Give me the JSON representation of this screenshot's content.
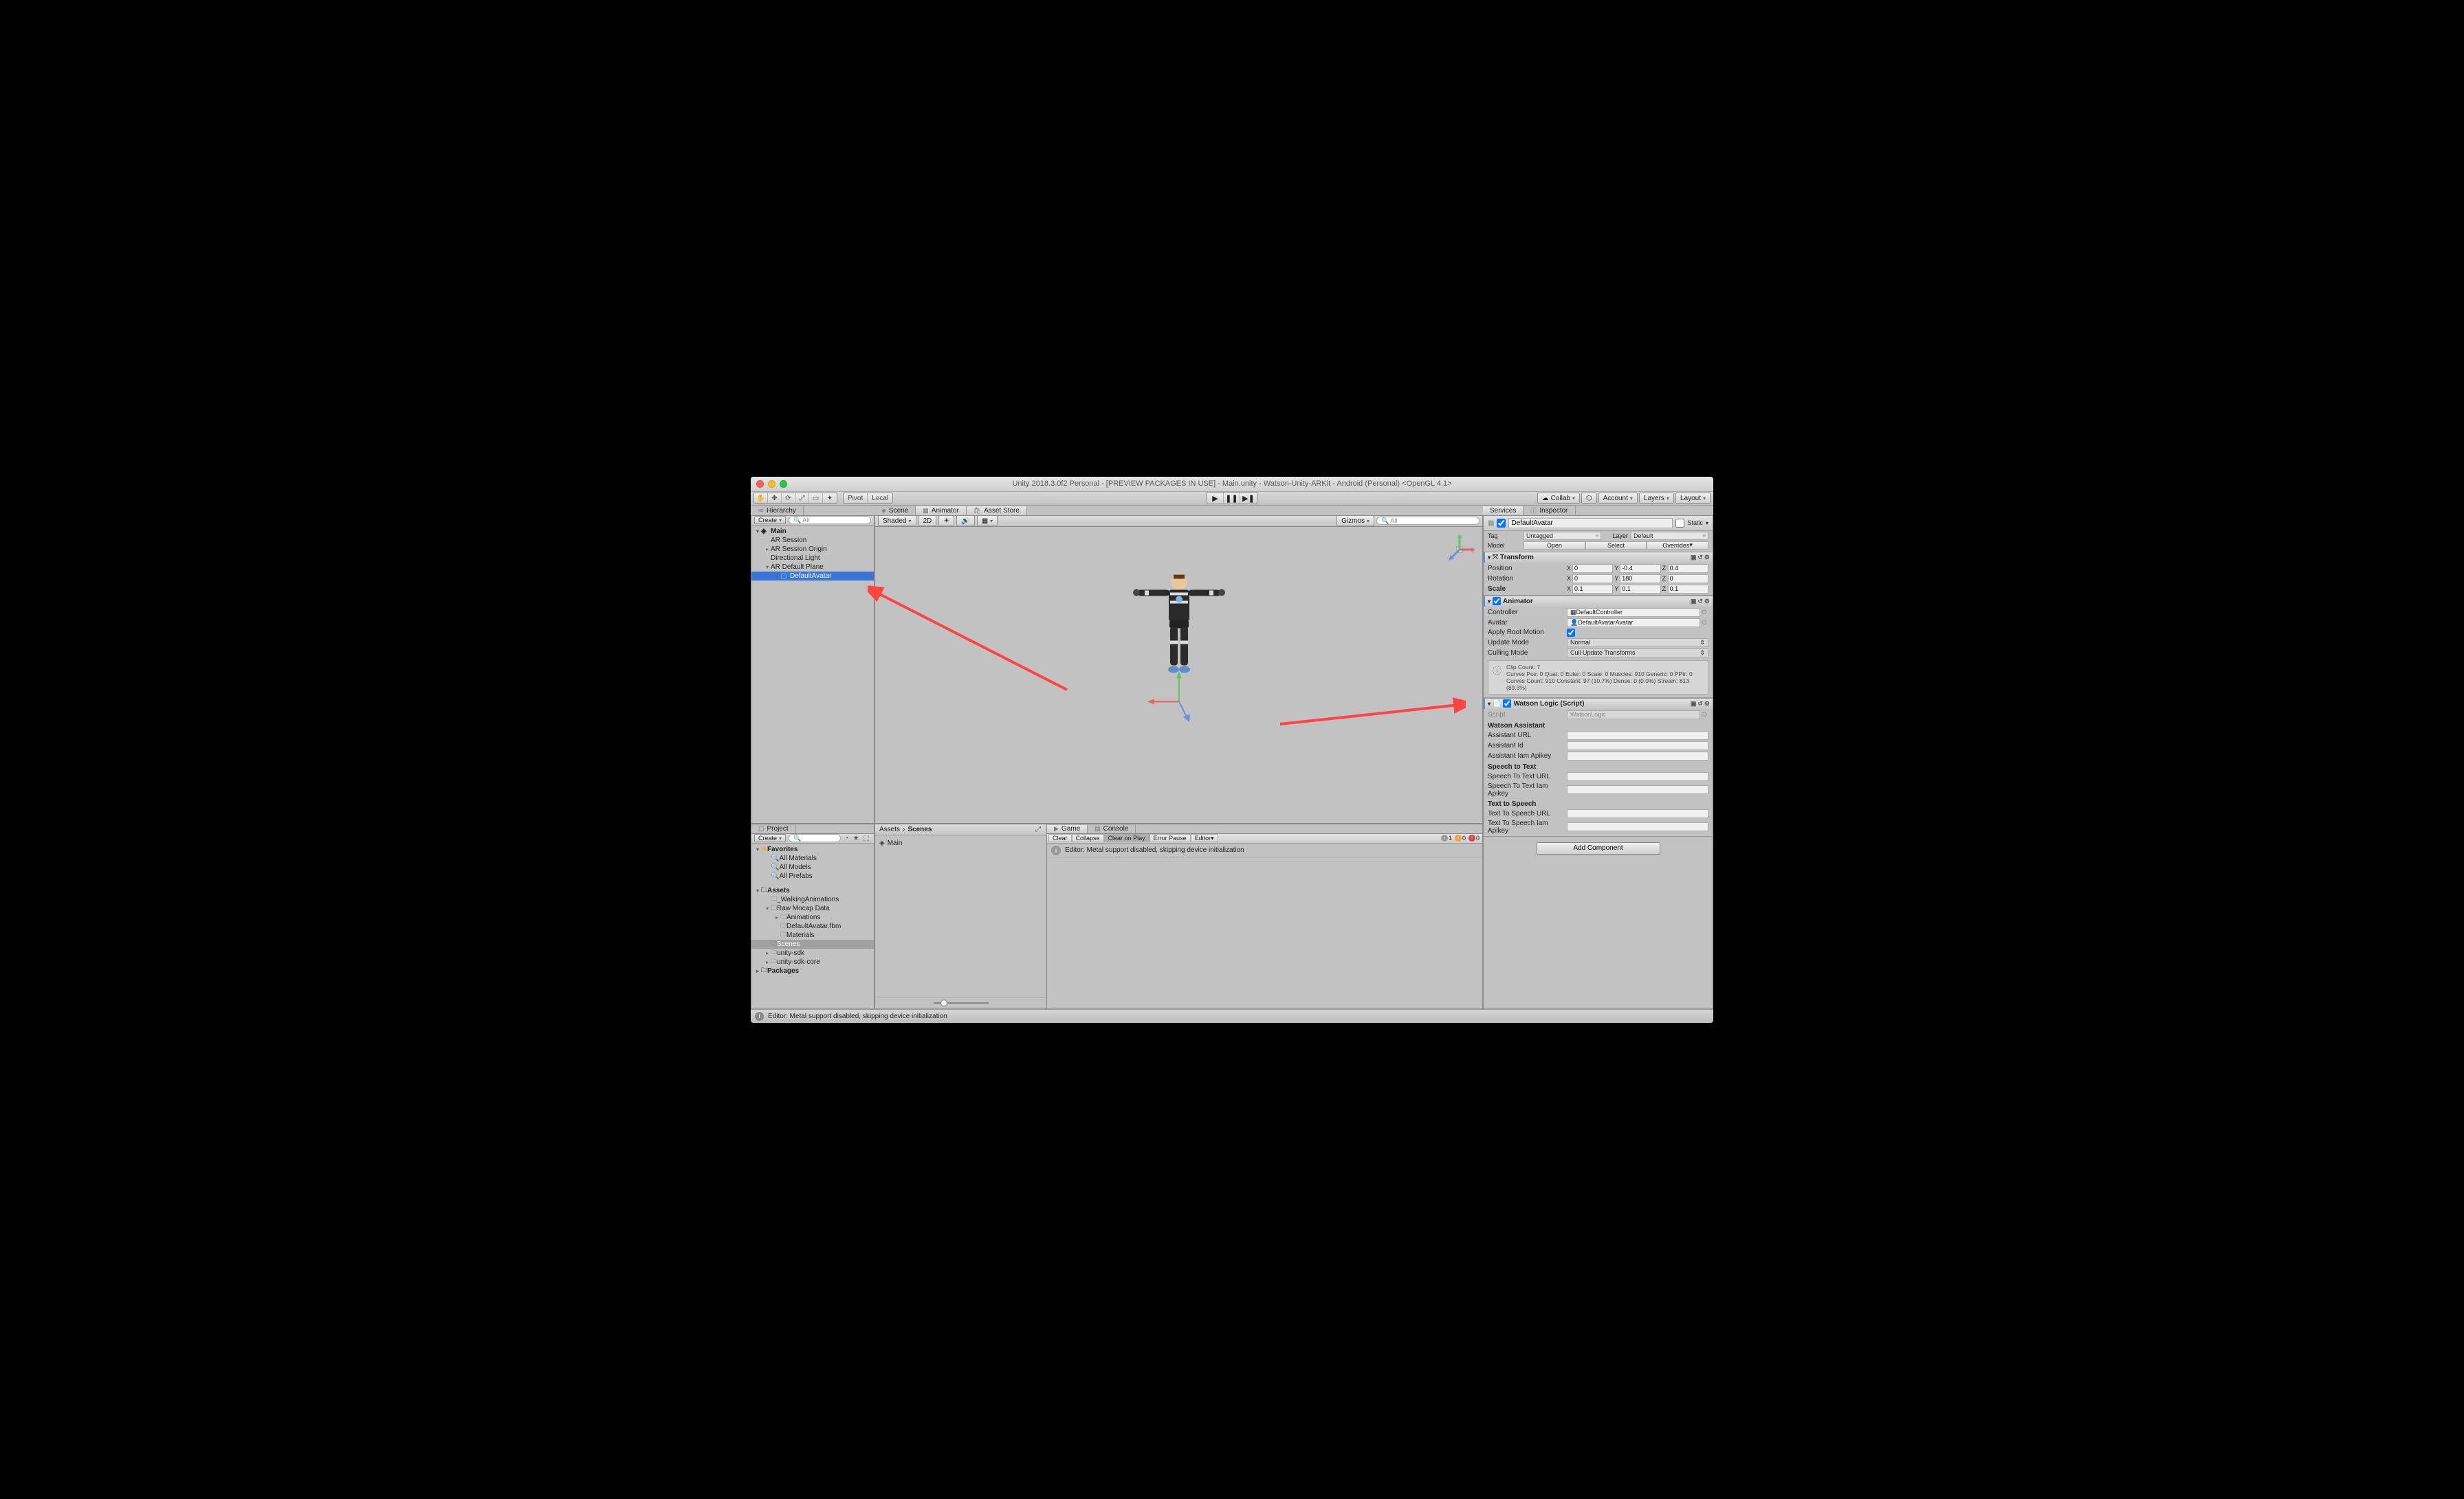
{
  "window": {
    "title": "Unity 2018.3.0f2 Personal - [PREVIEW PACKAGES IN USE] - Main.unity - Watson-Unity-ARKit - Android (Personal) <OpenGL 4.1>"
  },
  "toolbar": {
    "pivot": "Pivot",
    "local": "Local",
    "collab": "Collab",
    "account": "Account",
    "layers": "Layers",
    "layout": "Layout"
  },
  "hierarchy": {
    "tab": "Hierarchy",
    "create": "Create",
    "search": "All",
    "scene": "Main",
    "items": [
      "AR Session",
      "AR Session Origin",
      "Directional Light",
      "AR Default Plane",
      "DefaultAvatar"
    ]
  },
  "scene": {
    "tabs": [
      "Scene",
      "Animator",
      "Asset Store"
    ],
    "shaded": "Shaded",
    "twod": "2D",
    "gizmos": "Gizmos",
    "search": "All"
  },
  "services_tabs": [
    "Services",
    "Inspector"
  ],
  "inspector": {
    "name": "DefaultAvatar",
    "static": "Static",
    "tag_lbl": "Tag",
    "tag": "Untagged",
    "layer_lbl": "Layer",
    "layer": "Default",
    "model_lbl": "Model",
    "open": "Open",
    "select": "Select",
    "overrides": "Overrides",
    "transform": {
      "title": "Transform",
      "position": "Position",
      "rotation": "Rotation",
      "scale": "Scale",
      "px": "0",
      "py": "-0.4",
      "pz": "0.4",
      "rx": "0",
      "ry": "180",
      "rz": "0",
      "sx": "0.1",
      "sy": "0.1",
      "sz": "0.1"
    },
    "animator": {
      "title": "Animator",
      "controller_lbl": "Controller",
      "controller": "DefaultController",
      "avatar_lbl": "Avatar",
      "avatar": "DefaultAvatarAvatar",
      "root": "Apply Root Motion",
      "update_lbl": "Update Mode",
      "update": "Normal",
      "cull_lbl": "Culling Mode",
      "cull": "Cull Update Transforms",
      "info1": "Clip Count: 7",
      "info2": "Curves Pos: 0 Quat: 0 Euler: 0 Scale: 0 Muscles: 910 Generic: 0 PPtr: 0",
      "info3": "Curves Count: 910 Constant: 97 (10.7%) Dense: 0 (0.0%) Stream: 813 (89.3%)"
    },
    "watson": {
      "title": "Watson Logic (Script)",
      "script_lbl": "Script",
      "script": "WatsonLogic",
      "assistant_head": "Watson Assistant",
      "assistant_url": "Assistant URL",
      "assistant_id": "Assistant Id",
      "assistant_key": "Assistant Iam Apikey",
      "stt_head": "Speech to Text",
      "stt_url": "Speech To Text URL",
      "stt_key": "Speech To Text Iam Apikey",
      "tts_head": "Text to Speech",
      "tts_url": "Text To Speech URL",
      "tts_key": "Text To Speech Iam Apikey"
    },
    "add": "Add Component"
  },
  "project": {
    "tab": "Project",
    "create": "Create",
    "favorites": "Favorites",
    "all_materials": "All Materials",
    "all_models": "All Models",
    "all_prefabs": "All Prefabs",
    "assets": "Assets",
    "walking": "_WalkingAnimations",
    "raw": "Raw Mocap Data",
    "animations": "Animations",
    "defaultavatar": "DefaultAvatar.fbm",
    "materials": "Materials",
    "scenes": "Scenes",
    "unitysdk": "unity-sdk",
    "unitysdkcore": "unity-sdk-core",
    "packages": "Packages",
    "breadcrumb1": "Assets",
    "breadcrumb2": "Scenes",
    "item": "Main"
  },
  "console": {
    "tabs": [
      "Game",
      "Console"
    ],
    "clear": "Clear",
    "collapse": "Collapse",
    "clearplay": "Clear on Play",
    "errorpause": "Error Pause",
    "editor": "Editor",
    "msg": "Editor: Metal support disabled, skipping device initialization",
    "info_count": "1",
    "warn_count": "0",
    "err_count": "0"
  },
  "statusbar": {
    "msg": "Editor: Metal support disabled, skipping device initialization"
  }
}
